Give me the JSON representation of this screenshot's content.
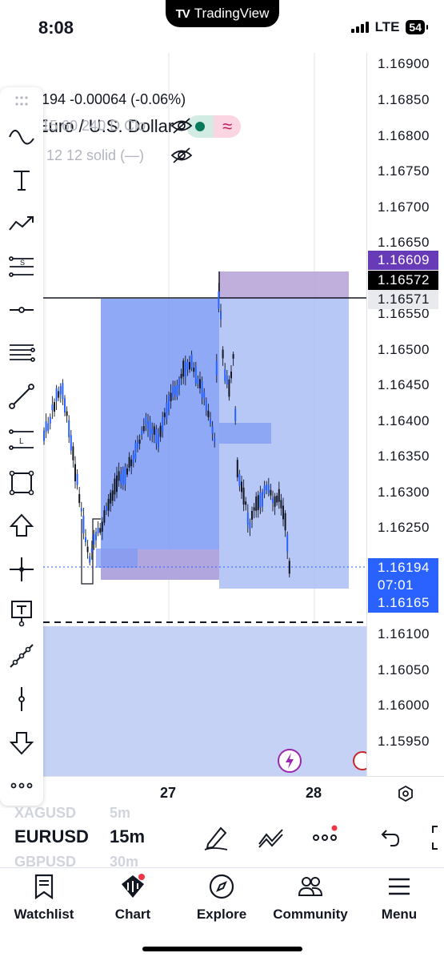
{
  "status_bar": {
    "time": "8:08",
    "app_badge": "TradingView",
    "network": "LTE",
    "battery": "54"
  },
  "legend": {
    "symbol_title": "Euro / U.S. Dollar",
    "ohlc_line": "194  -0.00064  (-0.06%)",
    "indicator_1": "15 60 240 D Clo",
    "indicator_2": "12 12 solid (—)"
  },
  "price_axis": {
    "ticks": [
      "1.16900",
      "1.16850",
      "1.16800",
      "1.16750",
      "1.16700",
      "1.16650",
      "1.16550",
      "1.16500",
      "1.16450",
      "1.16400",
      "1.16350",
      "1.16300",
      "1.16250",
      "1.16100",
      "1.16050",
      "1.16000",
      "1.15950"
    ],
    "tag_purple": "1.16609",
    "tag_black": "1.16572",
    "tag_gray": "1.16571",
    "tag_current": "1.16194",
    "tag_countdown": "07:01",
    "tag_blue2": "1.16165"
  },
  "time_axis": {
    "labels": [
      "27",
      "28"
    ]
  },
  "symbol_bar": {
    "ghost_above_symbol": "XAGUSD",
    "ghost_above_interval": "5m",
    "symbol": "EURUSD",
    "interval": "15m",
    "ghost_below_symbol": "GBPUSD",
    "ghost_below_interval": "30m"
  },
  "tabs": [
    {
      "label": "Watchlist",
      "icon": "watchlist-icon"
    },
    {
      "label": "Chart",
      "icon": "chart-icon"
    },
    {
      "label": "Explore",
      "icon": "compass-icon"
    },
    {
      "label": "Community",
      "icon": "community-icon"
    },
    {
      "label": "Menu",
      "icon": "menu-icon"
    }
  ],
  "colors": {
    "accent_blue": "#2962ff",
    "tag_purple": "#673ab7",
    "zone_blue": "#7b9af5",
    "zone_purple": "#b9a6d9",
    "candle": "#131722"
  }
}
